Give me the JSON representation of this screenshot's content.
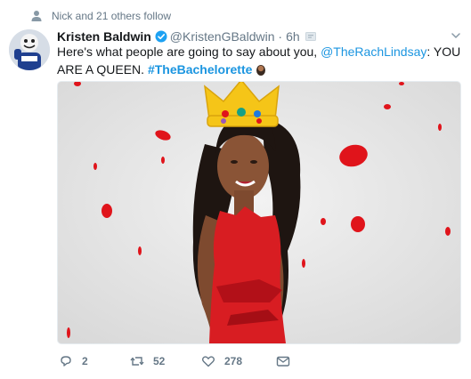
{
  "social_context": {
    "text": "Nick and 21 others follow"
  },
  "tweet": {
    "author": {
      "display_name": "Kristen Baldwin",
      "verified": true,
      "handle": "@KristenGBaldwin",
      "time": "6h"
    },
    "text": {
      "part1": "Here's what people are going to say about you, ",
      "mention": "@TheRachLindsay",
      "part2": ": YOU ARE A QUEEN. ",
      "hashtag": "#TheBachelorette"
    },
    "stats": {
      "replies": "2",
      "retweets": "52",
      "likes": "278"
    }
  },
  "colors": {
    "link": "#1b95e0",
    "muted": "#657786",
    "verified": "#1da1f2",
    "petal_red": "#e0141b"
  },
  "icons": [
    "person-icon",
    "verified-icon",
    "translate-icon",
    "caret-down-icon",
    "reply-icon",
    "retweet-icon",
    "like-icon",
    "message-icon"
  ]
}
